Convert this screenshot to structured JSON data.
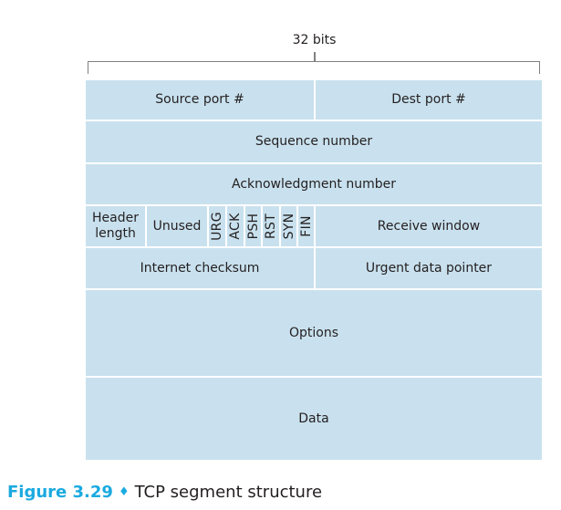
{
  "width_label": "32 bits",
  "rows": {
    "source_port": "Source port #",
    "dest_port": "Dest port #",
    "sequence_number": "Sequence number",
    "acknowledgment_number": "Acknowledgment number",
    "header_length": "Header length",
    "unused": "Unused",
    "flags": [
      "URG",
      "ACK",
      "PSH",
      "RST",
      "SYN",
      "FIN"
    ],
    "receive_window": "Receive window",
    "internet_checksum": "Internet checksum",
    "urgent_data_pointer": "Urgent data pointer",
    "options": "Options",
    "data": "Data"
  },
  "caption": {
    "figure_label": "Figure 3.29",
    "separator": "♦",
    "text": "TCP segment structure"
  },
  "colors": {
    "field_fill": "#c9e1ee",
    "caption_accent": "#1aaae0"
  }
}
